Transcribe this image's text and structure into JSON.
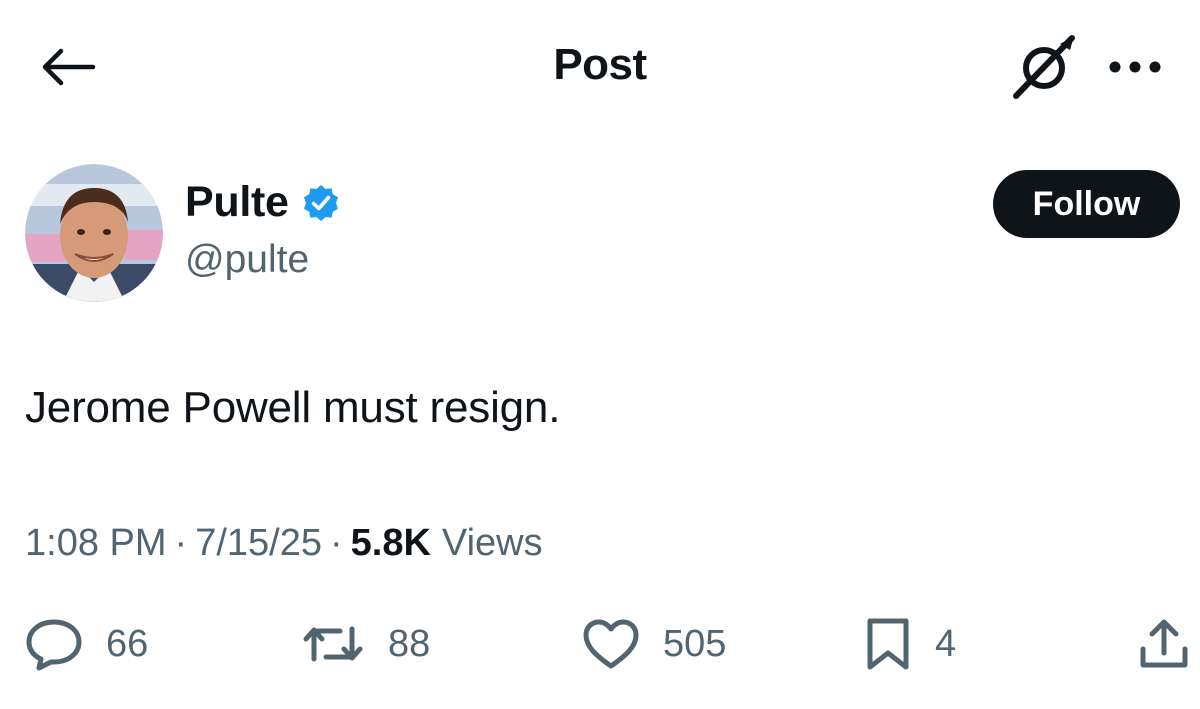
{
  "header": {
    "title": "Post",
    "back_icon": "arrow-left-icon",
    "grok_icon": "grok-icon",
    "more_icon": "more-horizontal-icon"
  },
  "author": {
    "display_name": "Pulte",
    "handle": "@pulte",
    "verified": true,
    "verified_color": "#1d9bf0",
    "follow_label": "Follow"
  },
  "post": {
    "text": "Jerome Powell must resign.",
    "time": "1:08 PM",
    "separator": "·",
    "date": "7/15/25",
    "views_count": "5.8K",
    "views_label": "Views"
  },
  "actions": {
    "reply": {
      "icon": "reply-icon",
      "count": "66"
    },
    "repost": {
      "icon": "repost-icon",
      "count": "88"
    },
    "like": {
      "icon": "heart-icon",
      "count": "505"
    },
    "bookmark": {
      "icon": "bookmark-icon",
      "count": "4"
    },
    "share": {
      "icon": "share-icon"
    }
  },
  "colors": {
    "text": "#0f1419",
    "secondary_text": "#536471",
    "button_bg": "#0f1419",
    "button_text": "#ffffff"
  }
}
